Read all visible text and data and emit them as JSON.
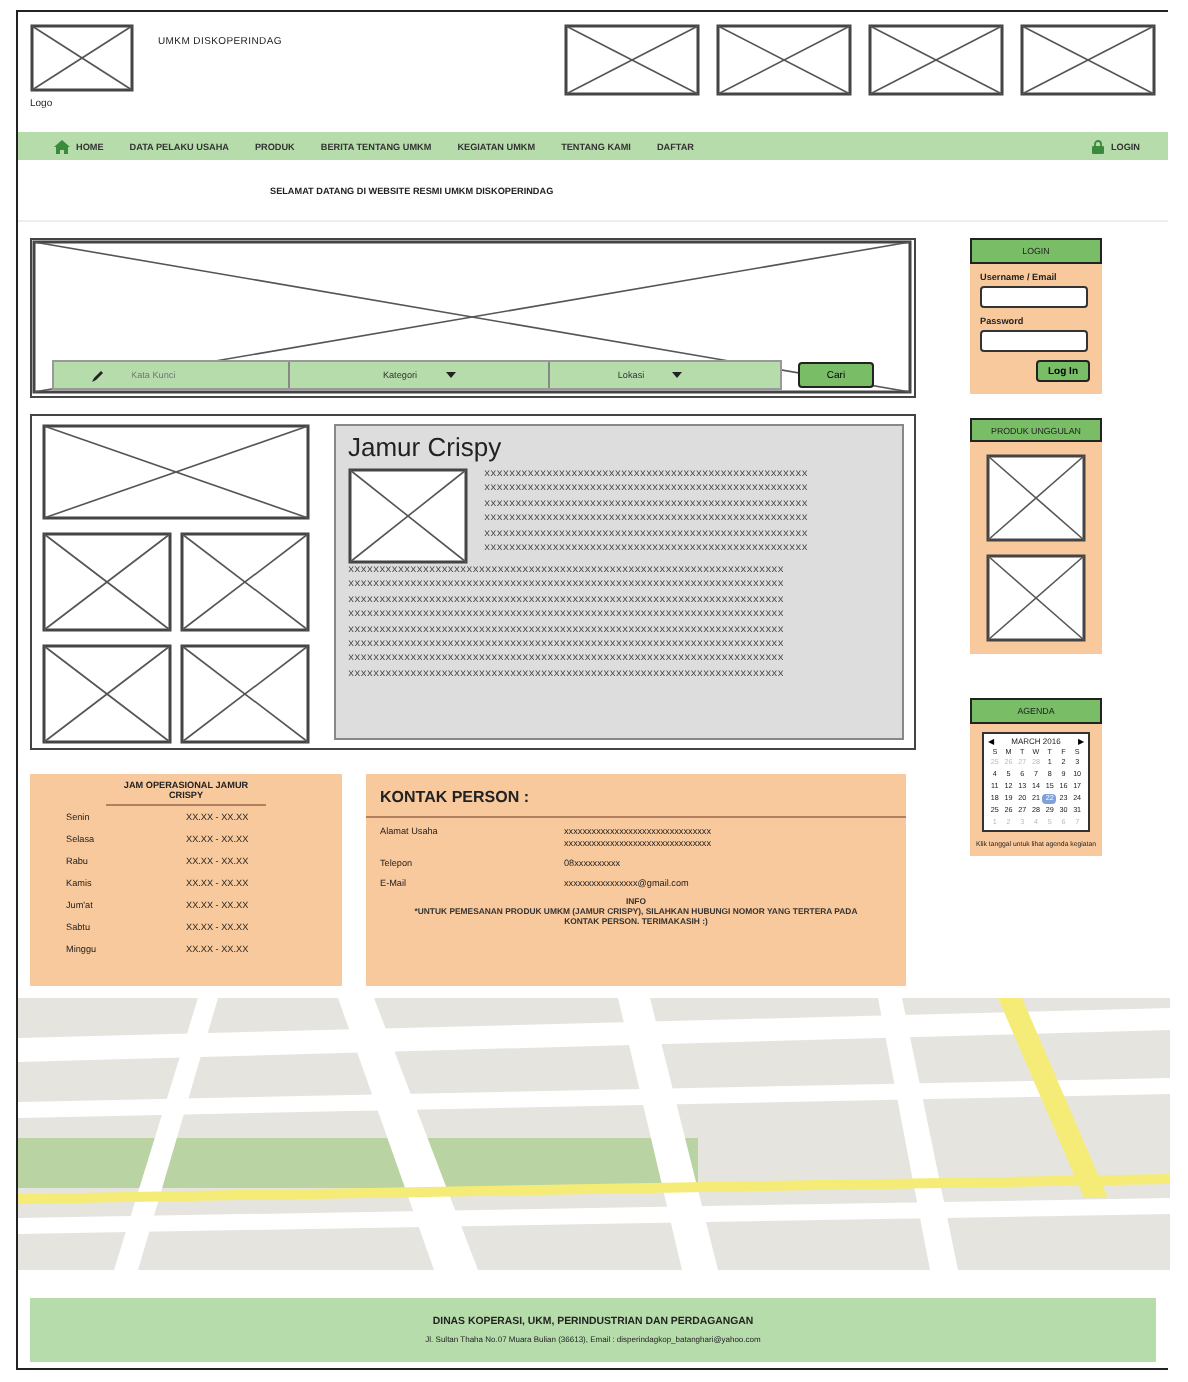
{
  "header": {
    "site_name": "UMKM DISKOPERINDAG",
    "logo_label": "Logo"
  },
  "nav": [
    {
      "label": "HOME",
      "kind": "home"
    },
    {
      "label": "DATA PELAKU USAHA",
      "kind": "page"
    },
    {
      "label": "PRODUK",
      "kind": "page"
    },
    {
      "label": "BERITA TENTANG UMKM",
      "kind": "page"
    },
    {
      "label": "KEGIATAN UMKM",
      "kind": "page"
    },
    {
      "label": "TENTANG KAMI",
      "kind": "page"
    },
    {
      "label": "DAFTAR",
      "kind": "page"
    },
    {
      "label": "LOGIN",
      "kind": "login"
    }
  ],
  "welcome": "SELAMAT DATANG DI WEBSITE RESMI UMKM DISKOPERINDAG",
  "search": {
    "keyword_placeholder": "Kata Kunci",
    "category": "Kategori",
    "location": "Lokasi",
    "button": "Cari"
  },
  "product": {
    "title": "Jamur Crispy",
    "short_lines": [
      "xxxxxxxxxxxxxxxxxxxxxxxxxxxxxxxxxxxxxxxxxxxxxxxxxxxx",
      "xxxxxxxxxxxxxxxxxxxxxxxxxxxxxxxxxxxxxxxxxxxxxxxxxxxx",
      "xxxxxxxxxxxxxxxxxxxxxxxxxxxxxxxxxxxxxxxxxxxxxxxxxxxx",
      "xxxxxxxxxxxxxxxxxxxxxxxxxxxxxxxxxxxxxxxxxxxxxxxxxxxx",
      "xxxxxxxxxxxxxxxxxxxxxxxxxxxxxxxxxxxxxxxxxxxxxxxxxxxx",
      "xxxxxxxxxxxxxxxxxxxxxxxxxxxxxxxxxxxxxxxxxxxxxxxxxxxx"
    ],
    "full_lines": [
      "xxxxxxxxxxxxxxxxxxxxxxxxxxxxxxxxxxxxxxxxxxxxxxxxxxxxxxxxxxxxxxxxxxxxxx",
      "xxxxxxxxxxxxxxxxxxxxxxxxxxxxxxxxxxxxxxxxxxxxxxxxxxxxxxxxxxxxxxxxxxxxxx",
      "xxxxxxxxxxxxxxxxxxxxxxxxxxxxxxxxxxxxxxxxxxxxxxxxxxxxxxxxxxxxxxxxxxxxxx",
      "xxxxxxxxxxxxxxxxxxxxxxxxxxxxxxxxxxxxxxxxxxxxxxxxxxxxxxxxxxxxxxxxxxxxxx",
      "xxxxxxxxxxxxxxxxxxxxxxxxxxxxxxxxxxxxxxxxxxxxxxxxxxxxxxxxxxxxxxxxxxxxxx",
      "xxxxxxxxxxxxxxxxxxxxxxxxxxxxxxxxxxxxxxxxxxxxxxxxxxxxxxxxxxxxxxxxxxxxxx",
      "xxxxxxxxxxxxxxxxxxxxxxxxxxxxxxxxxxxxxxxxxxxxxxxxxxxxxxxxxxxxxxxxxxxxxx",
      "xxxxxxxxxxxxxxxxxxxxxxxxxxxxxxxxxxxxxxxxxxxxxxxxxxxxxxxxxxxxxxxxxxxxxx"
    ]
  },
  "hours": {
    "title": "JAM OPERASIONAL JAMUR CRISPY",
    "rows": [
      {
        "day": "Senin",
        "time": "XX.XX - XX.XX"
      },
      {
        "day": "Selasa",
        "time": "XX.XX - XX.XX"
      },
      {
        "day": "Rabu",
        "time": "XX.XX - XX.XX"
      },
      {
        "day": "Kamis",
        "time": "XX.XX - XX.XX"
      },
      {
        "day": "Jum'at",
        "time": "XX.XX - XX.XX"
      },
      {
        "day": "Sabtu",
        "time": "XX.XX - XX.XX"
      },
      {
        "day": "Minggu",
        "time": "XX.XX - XX.XX"
      }
    ]
  },
  "contact": {
    "title": "KONTAK PERSON :",
    "rows": [
      {
        "label": "Alamat Usaha",
        "value": "xxxxxxxxxxxxxxxxxxxxxxxxxxxxxxxx xxxxxxxxxxxxxxxxxxxxxxxxxxxxxxxx"
      },
      {
        "label": "Telepon",
        "value": "08xxxxxxxxxx"
      },
      {
        "label": "E-Mail",
        "value": "xxxxxxxxxxxxxxxx@gmail.com"
      }
    ],
    "info_title": "INFO",
    "info_text": "*UNTUK PEMESANAN PRODUK UMKM (JAMUR CRISPY), SILAHKAN HUBUNGI NOMOR YANG TERTERA PADA KONTAK PERSON. TERIMAKASIH :)"
  },
  "login": {
    "title": "LOGIN",
    "username_label": "Username / Email",
    "password_label": "Password",
    "button": "Log In"
  },
  "featured": {
    "title": "PRODUK UNGGULAN"
  },
  "agenda": {
    "title": "AGENDA",
    "prev": "◀",
    "month": "MARCH 2016",
    "next": "▶",
    "weekdays": [
      "S",
      "M",
      "T",
      "W",
      "T",
      "F",
      "S"
    ],
    "weeks": [
      [
        {
          "day": "25",
          "muted": true,
          "selected": false
        },
        {
          "day": "26",
          "muted": true,
          "selected": false
        },
        {
          "day": "27",
          "muted": true,
          "selected": false
        },
        {
          "day": "28",
          "muted": true,
          "selected": false
        },
        {
          "day": "1",
          "muted": false,
          "selected": false
        },
        {
          "day": "2",
          "muted": false,
          "selected": false
        },
        {
          "day": "3",
          "muted": false,
          "selected": false
        }
      ],
      [
        {
          "day": "4",
          "muted": false,
          "selected": false
        },
        {
          "day": "5",
          "muted": false,
          "selected": false
        },
        {
          "day": "6",
          "muted": false,
          "selected": false
        },
        {
          "day": "7",
          "muted": false,
          "selected": false
        },
        {
          "day": "8",
          "muted": false,
          "selected": false
        },
        {
          "day": "9",
          "muted": false,
          "selected": false
        },
        {
          "day": "10",
          "muted": false,
          "selected": false
        }
      ],
      [
        {
          "day": "11",
          "muted": false,
          "selected": false
        },
        {
          "day": "12",
          "muted": false,
          "selected": false
        },
        {
          "day": "13",
          "muted": false,
          "selected": false
        },
        {
          "day": "14",
          "muted": false,
          "selected": false
        },
        {
          "day": "15",
          "muted": false,
          "selected": false
        },
        {
          "day": "16",
          "muted": false,
          "selected": false
        },
        {
          "day": "17",
          "muted": false,
          "selected": false
        }
      ],
      [
        {
          "day": "18",
          "muted": false,
          "selected": false
        },
        {
          "day": "19",
          "muted": false,
          "selected": false
        },
        {
          "day": "20",
          "muted": false,
          "selected": false
        },
        {
          "day": "21",
          "muted": false,
          "selected": false
        },
        {
          "day": "22",
          "muted": false,
          "selected": true
        },
        {
          "day": "23",
          "muted": false,
          "selected": false
        },
        {
          "day": "24",
          "muted": false,
          "selected": false
        }
      ],
      [
        {
          "day": "25",
          "muted": false,
          "selected": false
        },
        {
          "day": "26",
          "muted": false,
          "selected": false
        },
        {
          "day": "27",
          "muted": false,
          "selected": false
        },
        {
          "day": "28",
          "muted": false,
          "selected": false
        },
        {
          "day": "29",
          "muted": false,
          "selected": false
        },
        {
          "day": "30",
          "muted": false,
          "selected": false
        },
        {
          "day": "31",
          "muted": false,
          "selected": false
        }
      ],
      [
        {
          "day": "1",
          "muted": true,
          "selected": false
        },
        {
          "day": "2",
          "muted": true,
          "selected": false
        },
        {
          "day": "3",
          "muted": true,
          "selected": false
        },
        {
          "day": "4",
          "muted": true,
          "selected": false
        },
        {
          "day": "5",
          "muted": true,
          "selected": false
        },
        {
          "day": "6",
          "muted": true,
          "selected": false
        },
        {
          "day": "7",
          "muted": true,
          "selected": false
        }
      ]
    ],
    "hint": "Klik tanggal untuk lihat agenda kegiatan"
  },
  "footer": {
    "title": "DINAS KOPERASI, UKM, PERINDUSTRIAN DAN PERDAGANGAN",
    "address": "Jl. Sultan Thaha No.07 Muara Bulian (36613), Email : disperindagkop_batanghari@yahoo.com"
  }
}
